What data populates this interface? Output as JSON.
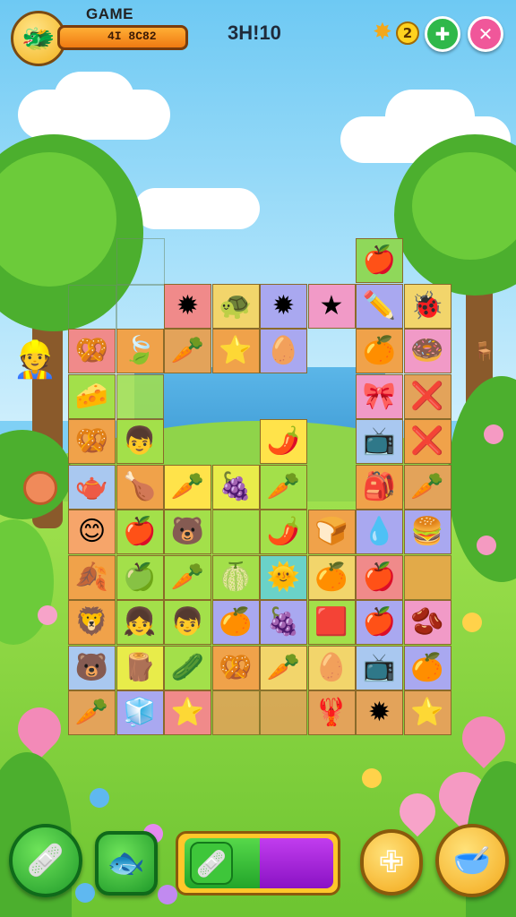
{
  "hud": {
    "title": "GAME",
    "progress_text": "4I 8C82",
    "timer": "3H!10",
    "coin_count": "2",
    "avatar_icon": "🐲",
    "coin_icon": "✸",
    "add_icon": "✚",
    "close_icon": "✕"
  },
  "board": {
    "rows": [
      [
        null,
        null,
        null,
        null,
        null,
        null,
        {
          "icon": "🍎",
          "color": "#8fd85a"
        },
        null
      ],
      [
        null,
        null,
        {
          "icon": "✹",
          "color": "#f08a8a"
        },
        {
          "icon": "🐢",
          "color": "#f2d56b"
        },
        {
          "icon": "✹",
          "color": "#a9a8f0"
        },
        {
          "icon": "★",
          "color": "#f19ac7"
        },
        {
          "icon": "✏️",
          "color": "#a9a8f0"
        },
        {
          "icon": "🐞",
          "color": "#f2d56b"
        }
      ],
      [
        {
          "icon": "🥨",
          "color": "#f08a8a"
        },
        {
          "icon": "🍃",
          "color": "#f0a24a"
        },
        {
          "icon": "🥕",
          "color": "#e3a35a"
        },
        {
          "icon": "⭐",
          "color": "#f0a24a"
        },
        {
          "icon": "🥚",
          "color": "#a9a8f0"
        },
        null,
        {
          "icon": "🍊",
          "color": "#f0a24a"
        },
        {
          "icon": "🍩",
          "color": "#f19ac7"
        }
      ],
      [
        {
          "icon": "🧀",
          "color": "#a3e04a"
        },
        {
          "icon": "",
          "color": "#a3e04a"
        },
        null,
        null,
        null,
        null,
        {
          "icon": "🎀",
          "color": "#f19ac7"
        },
        {
          "icon": "❌",
          "color": "#e3a35a"
        }
      ],
      [
        {
          "icon": "🥨",
          "color": "#f0a24a"
        },
        {
          "icon": "👦",
          "color": "#a3e04a"
        },
        null,
        null,
        {
          "icon": "🌶️",
          "color": "#ffe34a"
        },
        null,
        {
          "icon": "📺",
          "color": "#a9c8f0"
        },
        {
          "icon": "❌",
          "color": "#f0a24a"
        }
      ],
      [
        {
          "icon": "🫖",
          "color": "#a9c8f0"
        },
        {
          "icon": "🍗",
          "color": "#f0a24a"
        },
        {
          "icon": "🥕",
          "color": "#ffe34a"
        },
        {
          "icon": "🍇",
          "color": "#e8ec4a"
        },
        {
          "icon": "🥕",
          "color": "#a3e04a"
        },
        null,
        {
          "icon": "🎒",
          "color": "#f0a24a"
        },
        {
          "icon": "🥕",
          "color": "#e3a35a"
        }
      ],
      [
        {
          "icon": "😊",
          "color": "#f6a56a"
        },
        {
          "icon": "🍎",
          "color": "#a3e04a"
        },
        {
          "icon": "🐻",
          "color": "#a3e04a"
        },
        {
          "icon": "",
          "color": "#a3e04a"
        },
        {
          "icon": "🌶️",
          "color": "#a3e04a"
        },
        {
          "icon": "🍞",
          "color": "#f0a24a"
        },
        {
          "icon": "💧",
          "color": "#a9a8f0"
        },
        {
          "icon": "🍔",
          "color": "#a9a8f0"
        }
      ],
      [
        {
          "icon": "🍂",
          "color": "#f0a24a"
        },
        {
          "icon": "🍏",
          "color": "#a3e04a"
        },
        {
          "icon": "🥕",
          "color": "#a3e04a"
        },
        {
          "icon": "🍈",
          "color": "#a3e04a"
        },
        {
          "icon": "🌞",
          "color": "#6ad2c8"
        },
        {
          "icon": "🍊",
          "color": "#f2d56b"
        },
        {
          "icon": "🍎",
          "color": "#f08a8a"
        },
        {
          "icon": "",
          "color": "#f0a24a"
        }
      ],
      [
        {
          "icon": "🦁",
          "color": "#f0a24a"
        },
        {
          "icon": "👧",
          "color": "#a3e04a"
        },
        {
          "icon": "👦",
          "color": "#a3e04a"
        },
        {
          "icon": "🍊",
          "color": "#a9a8f0"
        },
        {
          "icon": "🍇",
          "color": "#a9a8f0"
        },
        {
          "icon": "🟥",
          "color": "#a3e04a"
        },
        {
          "icon": "🍎",
          "color": "#a9a8f0"
        },
        {
          "icon": "🫘",
          "color": "#f19ac7"
        }
      ],
      [
        {
          "icon": "🐻",
          "color": "#a9c8f0"
        },
        {
          "icon": "🪵",
          "color": "#e8ec4a"
        },
        {
          "icon": "🥒",
          "color": "#a3e04a"
        },
        {
          "icon": "🥨",
          "color": "#f0a24a"
        },
        {
          "icon": "🥕",
          "color": "#f2d56b"
        },
        {
          "icon": "🥚",
          "color": "#f2d56b"
        },
        {
          "icon": "📺",
          "color": "#a9c8f0"
        },
        {
          "icon": "🍊",
          "color": "#a9a8f0"
        }
      ],
      [
        {
          "icon": "🥕",
          "color": "#e3a35a"
        },
        {
          "icon": "🧊",
          "color": "#a9a8f0"
        },
        {
          "icon": "⭐",
          "color": "#f08a8a"
        },
        {
          "icon": "",
          "color": "#e3a35a"
        },
        {
          "icon": "",
          "color": "#e3a35a"
        },
        {
          "icon": "🦞",
          "color": "#e3a35a"
        },
        {
          "icon": "✹",
          "color": "#e3a35a"
        },
        {
          "icon": "⭐",
          "color": "#e3a35a"
        }
      ]
    ]
  },
  "bottom_bar": {
    "hint_icon": "🩹",
    "shuffle_icon": "🐟",
    "meter_icon": "🩹",
    "meter_fill_green": 0.5,
    "pause_icon": "✙",
    "shop_icon": "🥣"
  },
  "colors": {
    "board_border": "#8a6a2a",
    "close_button": "#f0579a",
    "add_button": "#2fb84a",
    "hint_button": "#34c23c",
    "pause_button": "#ffc72a"
  }
}
